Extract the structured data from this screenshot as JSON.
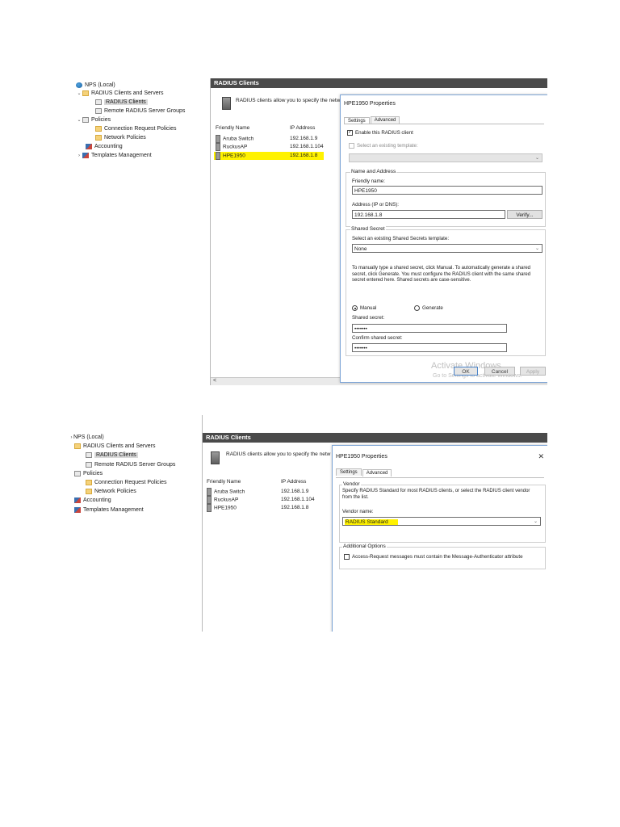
{
  "nps_tree": {
    "items": [
      {
        "label": "NPS (Local)",
        "icon": "globe-icon"
      },
      {
        "label": "RADIUS Clients and Servers",
        "icon": "folder-icon"
      },
      {
        "label": "RADIUS Clients",
        "icon": "document-icon"
      },
      {
        "label": "Remote RADIUS Server Groups",
        "icon": "document-icon"
      },
      {
        "label": "Policies",
        "icon": "folder-icon"
      },
      {
        "label": "Connection Request Policies",
        "icon": "folder-icon"
      },
      {
        "label": "Network Policies",
        "icon": "folder-icon"
      },
      {
        "label": "Accounting",
        "icon": "accounting-icon"
      },
      {
        "label": "Templates Management",
        "icon": "templates-icon"
      }
    ]
  },
  "main": {
    "title": "RADIUS Clients",
    "intro": "RADIUS clients allow you to specify the netw",
    "columns": {
      "name": "Friendly Name",
      "ip": "IP Address"
    },
    "rows": [
      {
        "name": "Aruba Switch",
        "ip": "192.168.1.9"
      },
      {
        "name": "RuckusAP",
        "ip": "192.168.1.104"
      },
      {
        "name": "HPE1950",
        "ip": "192.168.1.8"
      }
    ],
    "scroll_left": "<"
  },
  "dialog": {
    "title": "HPE1950 Properties",
    "close": "✕",
    "tabs": [
      "Settings",
      "Advanced"
    ],
    "settings": {
      "enable_label": "Enable this RADIUS client",
      "template_label": "Select an existing template:",
      "group_name_address": "Name and Address",
      "friendly_name_label": "Friendly name:",
      "friendly_name_value": "HPE1950",
      "address_label": "Address (IP or DNS):",
      "address_value": "192.168.1.8",
      "verify_button": "Verify...",
      "group_shared_secret": "Shared Secret",
      "secret_template_label": "Select an existing Shared Secrets template:",
      "secret_template_value": "None",
      "secret_help": "To manually type a shared secret, click Manual. To automatically generate a shared secret, click Generate. You must configure the RADIUS client with the same shared secret entered here. Shared secrets are case-sensitive.",
      "manual_label": "Manual",
      "generate_label": "Generate",
      "shared_secret_label": "Shared secret:",
      "shared_secret_value": "•••••••",
      "confirm_secret_label": "Confirm shared secret:",
      "confirm_secret_value": "•••••••",
      "ok_button": "OK",
      "cancel_button": "Cancel",
      "apply_button": "Apply"
    },
    "advanced": {
      "vendor_group": "Vendor",
      "vendor_help": "Specify RADIUS Standard for most RADIUS clients, or select the RADIUS client vendor from the list.",
      "vendor_name_label": "Vendor name:",
      "vendor_name_value": "RADIUS Standard",
      "options_group": "Additional Options",
      "message_auth_label": "Access-Request messages must contain the Message-Authenticator attribute"
    }
  },
  "watermark": {
    "line1": "Activate Windows",
    "line2": "Go to Settings to activate Windows."
  },
  "colors": {
    "highlight": "#fff200",
    "header_bar": "#4a4a4a",
    "dialog_border": "#7fa6d6"
  }
}
